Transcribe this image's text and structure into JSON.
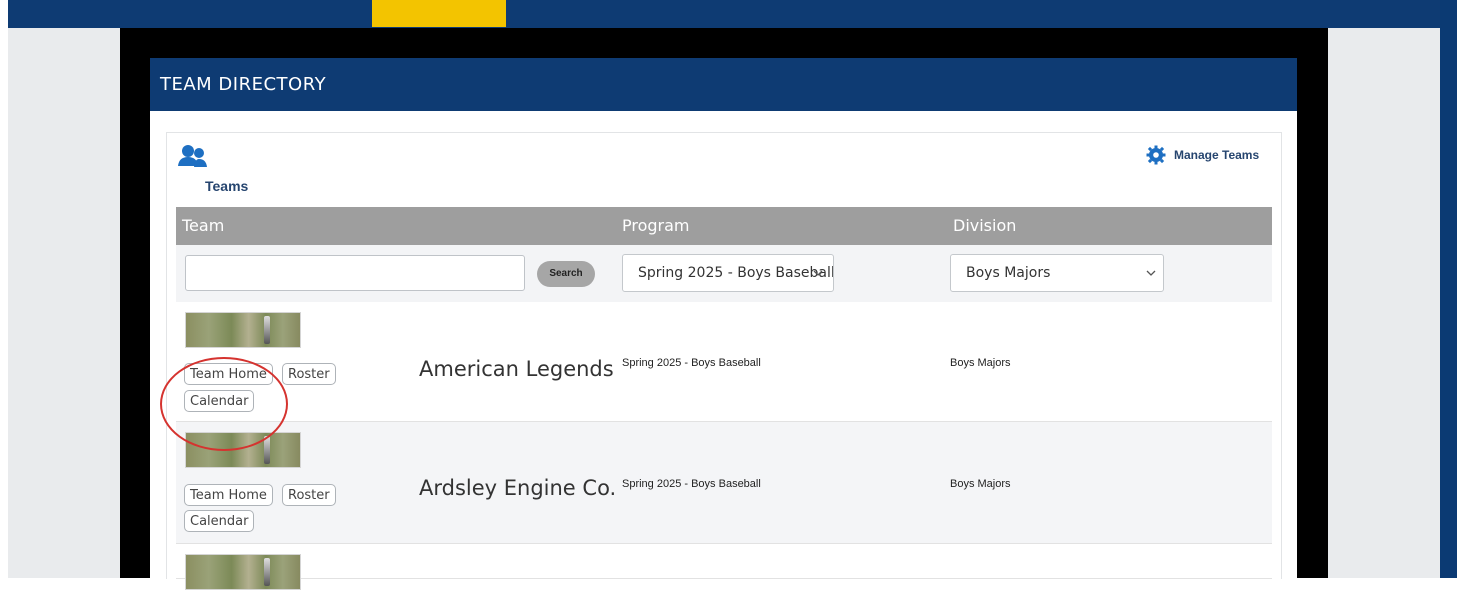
{
  "page": {
    "title": "TEAM DIRECTORY",
    "colors": {
      "nav": "#0e3b73",
      "accent": "#f3c400",
      "table_header": "#9e9e9e",
      "link": "#26456f"
    }
  },
  "section": {
    "label": "Teams",
    "icon": "users-icon",
    "manage_label": "Manage Teams",
    "manage_icon": "gear-icon"
  },
  "table": {
    "columns": [
      "Team",
      "Program",
      "Division"
    ],
    "filters": {
      "search_value": "",
      "search_button": "Search",
      "program_selected": "Spring 2025 - Boys Baseball",
      "division_selected": "Boys Majors"
    },
    "rows": [
      {
        "team": "American Legends",
        "program": "Spring 2025 - Boys Baseball",
        "division": "Boys Majors",
        "buttons": [
          "Team Home",
          "Roster",
          "Calendar"
        ]
      },
      {
        "team": "Ardsley Engine Co.",
        "program": "Spring 2025 - Boys Baseball",
        "division": "Boys Majors",
        "buttons": [
          "Team Home",
          "Roster",
          "Calendar"
        ]
      }
    ]
  }
}
